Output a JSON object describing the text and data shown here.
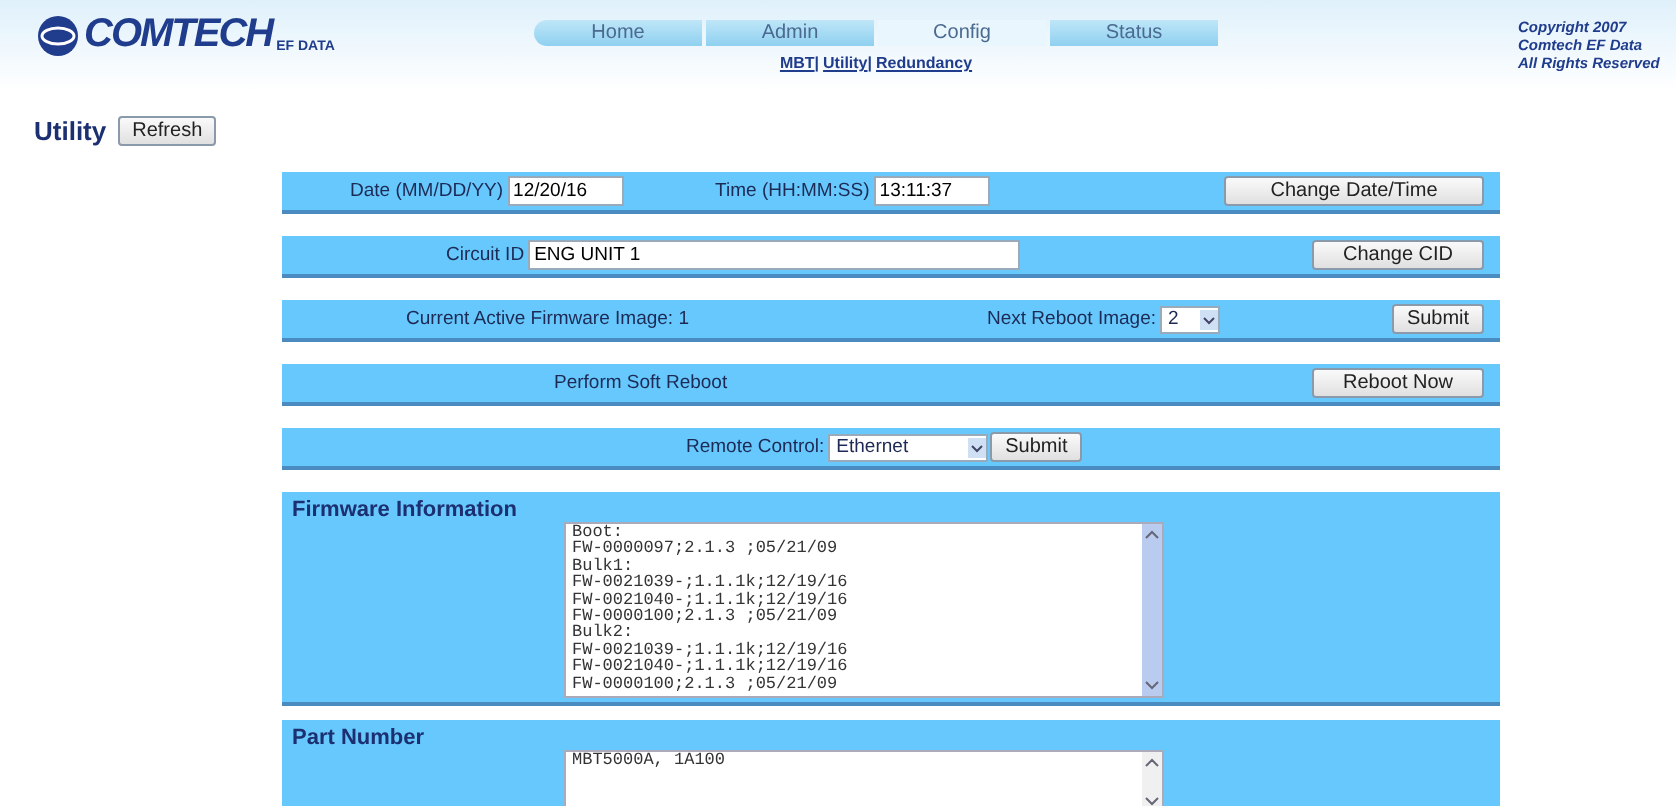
{
  "logo": {
    "name": "COMTECH",
    "sub": "EF DATA"
  },
  "tabs": [
    {
      "label": "Home",
      "selected": false
    },
    {
      "label": "Admin",
      "selected": false
    },
    {
      "label": "Config",
      "selected": true
    },
    {
      "label": "Status",
      "selected": false
    }
  ],
  "sub_links": [
    {
      "kind": "link",
      "text": "MBT"
    },
    {
      "kind": "separator",
      "text": "|"
    },
    {
      "kind": "link",
      "text": "Utility"
    },
    {
      "kind": "separator",
      "text": "|"
    },
    {
      "kind": "link",
      "text": "Redundancy"
    }
  ],
  "copyright": [
    "Copyright 2007",
    "Comtech EF Data",
    "All Rights Reserved"
  ],
  "page": {
    "title": "Utility",
    "refresh": "Refresh"
  },
  "date_time": {
    "date_label": "Date (MM/DD/YY)",
    "date": "12/20/16",
    "time_label": "Time (HH:MM:SS)",
    "time": "13:11:37",
    "button": "Change Date/Time"
  },
  "circuit": {
    "label": "Circuit ID",
    "value": "ENG UNIT 1",
    "button": "Change CID"
  },
  "firmware_image": {
    "current": "Current Active Firmware Image: 1",
    "next_label": "Next Reboot Image:",
    "next": "2",
    "button": "Submit"
  },
  "reboot": {
    "label": "Perform Soft Reboot",
    "button": "Reboot Now"
  },
  "remote": {
    "label": "Remote Control:",
    "value": "Ethernet",
    "button": "Submit"
  },
  "firmware_info": {
    "title": "Firmware Information",
    "lines": [
      "Boot:",
      "FW-0000097;2.1.3 ;05/21/09",
      "Bulk1:",
      "FW-0021039-;1.1.1k;12/19/16",
      "FW-0021040-;1.1.1k;12/19/16",
      "FW-0000100;2.1.3 ;05/21/09",
      "Bulk2:",
      "FW-0021039-;1.1.1k;12/19/16",
      "FW-0021040-;1.1.1k;12/19/16",
      "FW-0000100;2.1.3 ;05/21/09"
    ]
  },
  "part_number": {
    "title": "Part Number",
    "lines": [
      "MBT5000A, 1A100"
    ]
  }
}
